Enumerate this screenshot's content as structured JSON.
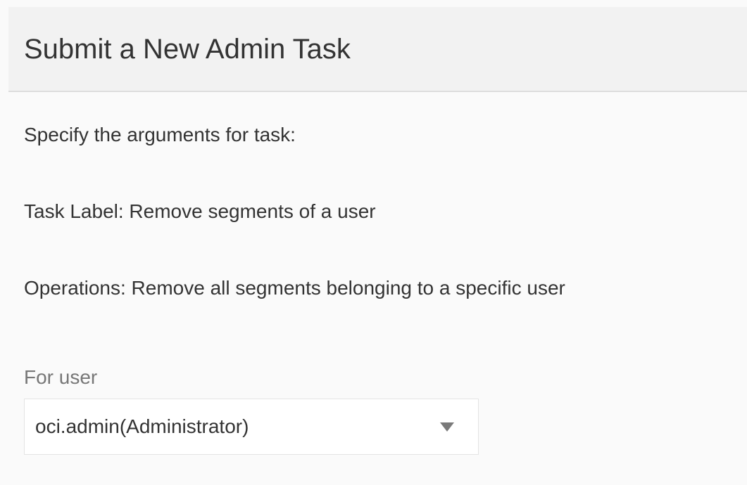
{
  "dialog": {
    "title": "Submit a New Admin Task"
  },
  "content": {
    "intro": "Specify the arguments for task:",
    "task_label": "Task Label: Remove segments of a user",
    "operations": "Operations: Remove all segments belonging to a specific user"
  },
  "form": {
    "user_field": {
      "label": "For user",
      "selected_value": "oci.admin(Administrator)",
      "icon": "chevron-down-icon"
    }
  }
}
